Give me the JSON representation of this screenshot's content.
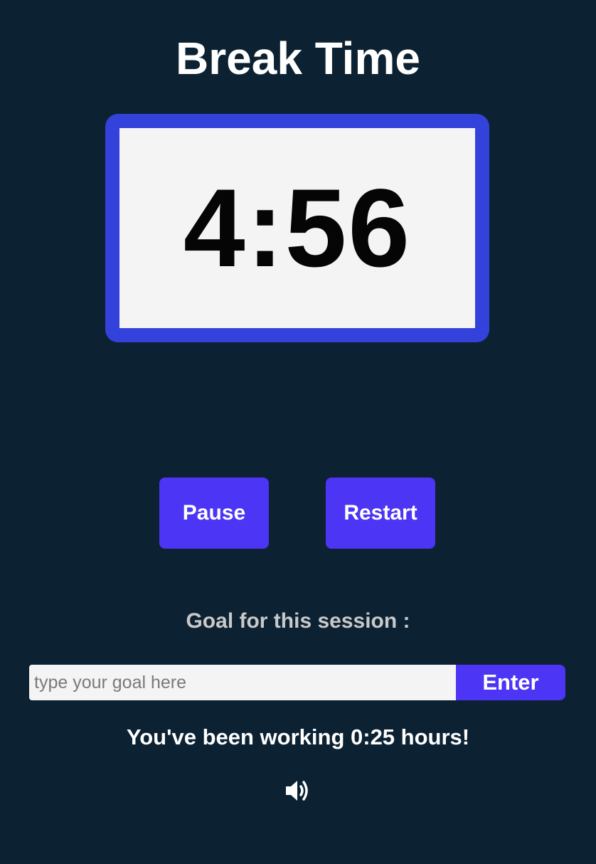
{
  "header": {
    "title": "Break Time"
  },
  "timer": {
    "display": "4:56"
  },
  "controls": {
    "pause_label": "Pause",
    "restart_label": "Restart"
  },
  "goal": {
    "label": "Goal for this session :",
    "input_value": "",
    "placeholder": "type your goal here",
    "enter_label": "Enter"
  },
  "status": {
    "working_text": "You've been working 0:25 hours!"
  },
  "icons": {
    "sound": "volume-icon"
  },
  "colors": {
    "background": "#0c2233",
    "timer_frame": "#3342da",
    "timer_screen": "#f4f4f4",
    "button": "#4c35f5",
    "text": "#ffffff",
    "label": "#c9c9c9"
  }
}
